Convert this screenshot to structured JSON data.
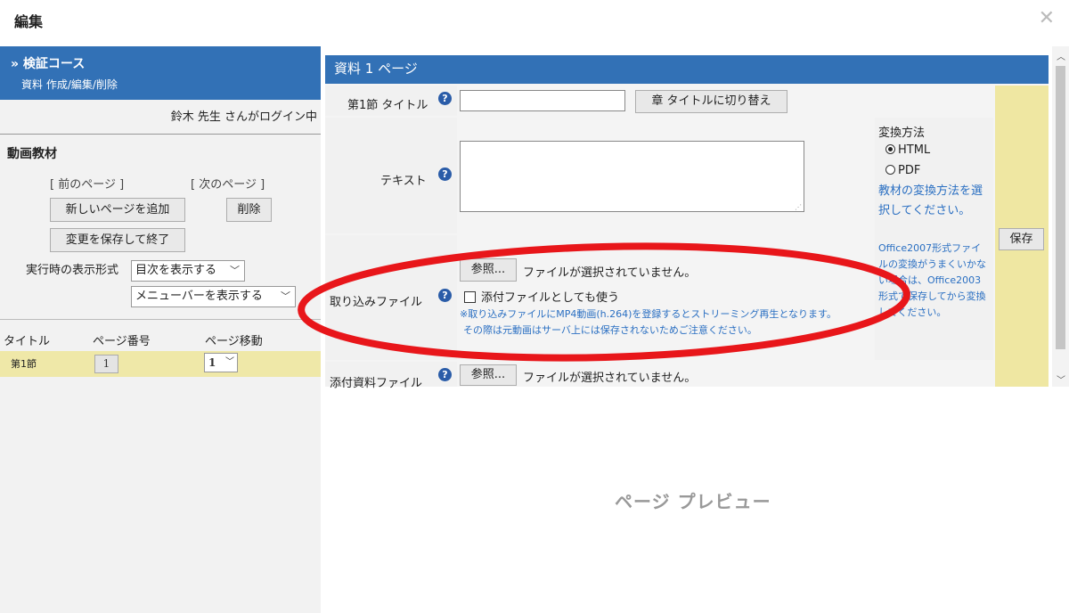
{
  "dialog": {
    "title": "編集"
  },
  "left": {
    "course_title": "» 検証コース",
    "course_sub": "資料 作成/編集/削除",
    "login_text": "鈴木 先生 さんがログイン中",
    "section_title": "動画教材",
    "prev_page": "[ 前のページ ]",
    "next_page": "[ 次のページ ]",
    "add_page_button": "新しいページを追加",
    "delete_button": "削除",
    "save_finish_button": "変更を保存して終了",
    "display_label": "実行時の表示形式",
    "toc_select": "目次を表示する",
    "menu_select": "メニューバーを表示する",
    "columns": [
      "タイトル",
      "ページ番号",
      "ページ移動"
    ],
    "rows": [
      {
        "title": "第1節",
        "page_no": "1",
        "move": "1"
      }
    ]
  },
  "editor": {
    "page_header": "資料 1 ページ",
    "title_label": "第1節 タイトル",
    "chapter_switch_button": "章 タイトルに切り替え",
    "text_label": "テキスト",
    "conversion": {
      "label": "変換方法",
      "options": [
        "HTML",
        "PDF"
      ],
      "selected": "HTML",
      "hint": "教材の変換方法を選択してください。",
      "office_note": "Office2007形式ファイルの変換がうまくいかない場合は、Office2003形式で保存してから変換してください。"
    },
    "import_label": "取り込みファイル",
    "browse_button": "参照...",
    "no_file": "ファイルが選択されていません。",
    "use_as_attachment": "添付ファイルとしても使う",
    "import_note_1": "※取り込みファイルにMP4動画(h.264)を登録するとストリーミング再生となります。",
    "import_note_2": "その際は元動画はサーバ上には保存されないためご注意ください。",
    "attach_label": "添付資料ファイル",
    "attach_browse_button": "参照...",
    "attach_no_file": "ファイルが選択されていません。",
    "save_button": "保存"
  },
  "preview": {
    "label": "ページ プレビュー"
  },
  "colors": {
    "header_blue": "#3271b6",
    "row_yellow": "#efe8a8",
    "annotation_red": "#e8161a",
    "link_blue": "#2a6fc2"
  }
}
